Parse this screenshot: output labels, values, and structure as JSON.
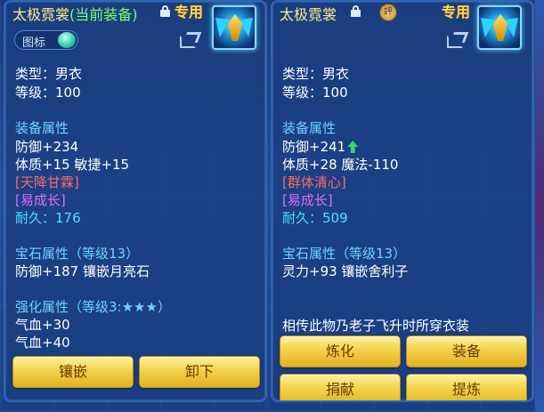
{
  "left_panel": {
    "title": "太极霓裳",
    "equipped_tag": "(当前装备)",
    "exclusive": "专用",
    "badge_label": "图标",
    "type_line": "类型：男衣",
    "level_line": "等级：100",
    "equip_attr_header": "装备属性",
    "defense": "防御+234",
    "stats": "体质+15 敏捷+15",
    "special_skill": "[天降甘霖]",
    "special_effect": "[易成长]",
    "durability": "耐久：176",
    "gem_header": "宝石属性（等级13）",
    "gem_line": "防御+187 镶嵌月亮石",
    "enhance_header": "强化属性（等级3:★★★）",
    "enhance_1": "气血+30",
    "enhance_2": "气血+40",
    "buttons": {
      "inlay": "镶嵌",
      "unequip": "卸下"
    }
  },
  "right_panel": {
    "title": "太极霓裳",
    "seal_glyph": "評",
    "exclusive": "专用",
    "type_line": "类型：男衣",
    "level_line": "等级：100",
    "equip_attr_header": "装备属性",
    "defense": "防御+241",
    "stats": "体质+28 魔法-110",
    "special_skill": "[群体清心]",
    "special_effect": "[易成长]",
    "durability": "耐久：509",
    "gem_header": "宝石属性（等级13）",
    "gem_line": "灵力+93 镶嵌舍利子",
    "description": "相传此物乃老子飞升时所穿衣装",
    "buttons": {
      "refine": "炼化",
      "equip": "装备",
      "donate": "捐献",
      "extract": "提炼"
    }
  },
  "colors": {
    "title": "#ffe98a",
    "equipped_tag": "#7dff6a",
    "section_header": "#6fd3ff",
    "special_skill": "#ff6a6a",
    "special_effect": "#e06cff",
    "durability": "#4fe0ff",
    "button_gold": "#f3d24c"
  },
  "icons": [
    "lock-icon",
    "toggle-icon",
    "share-icon",
    "item-icon",
    "seal-icon",
    "up-arrow-icon"
  ]
}
